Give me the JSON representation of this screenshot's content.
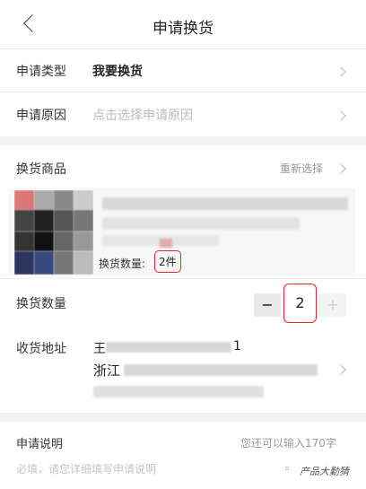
{
  "header": {
    "title": "申请换货"
  },
  "request_type": {
    "label": "申请类型",
    "value": "我要换货"
  },
  "request_reason": {
    "label": "申请原因",
    "placeholder": "点击选择申请原因"
  },
  "goods": {
    "label": "换货商品",
    "reselect": "重新选择",
    "quantity_caption": "换货数量:",
    "quantity_value": "2件"
  },
  "quantity": {
    "label": "换货数量",
    "minus": "−",
    "value": "2",
    "plus": "+"
  },
  "address": {
    "label": "收货地址",
    "line1_prefix": "王",
    "line1_suffix": "1",
    "line2_prefix": "浙江"
  },
  "description": {
    "label": "申请说明",
    "remaining": "您还可以输入170字",
    "placeholder": "必填，请您详细填写申请说明"
  },
  "watermark": {
    "text": "产品大勤猜"
  },
  "colors": {
    "accent_red": "#e0262f",
    "background": "#f2f2f2"
  }
}
